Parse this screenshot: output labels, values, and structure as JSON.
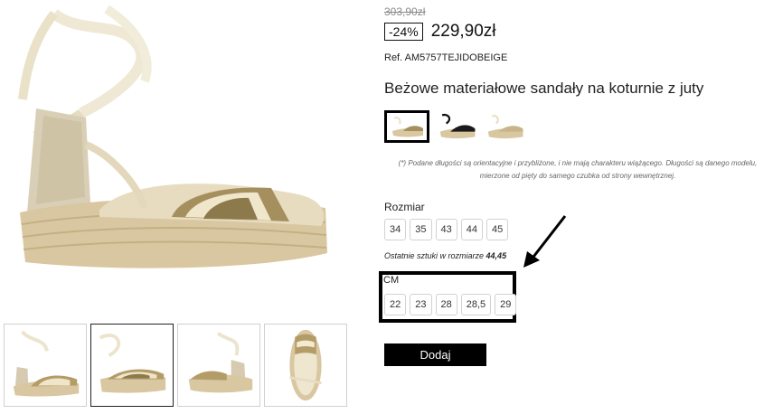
{
  "product": {
    "old_price": "303,90zł",
    "discount": "-24%",
    "price": "229,90zł",
    "reference": "Ref. AM5757TEJIDOBEIGE",
    "title": "Beżowe materiałowe sandały na koturnie z juty"
  },
  "color_options": [
    {
      "name": "beige-icon",
      "selected": true
    },
    {
      "name": "black-icon",
      "selected": false
    },
    {
      "name": "beige-alt-icon",
      "selected": false
    }
  ],
  "disclaimer": {
    "line1": "(*) Podane długości są orientacyjne i przybliżone, i nie mają charakteru wiążącego. Długości są danego modelu,",
    "line2": "mierzone od pięty do samego czubka od strony wewnętrznej."
  },
  "sizes": {
    "label": "Rozmiar",
    "eu": [
      "34",
      "35",
      "43",
      "44",
      "45"
    ],
    "last_pieces_text": "Ostatnie sztuki w rozmiarze",
    "last_pieces_sizes": "44,45",
    "cm_label": "CM",
    "cm": [
      "22",
      "23",
      "28",
      "28,5",
      "29"
    ]
  },
  "add_button": "Dodaj",
  "gallery": {
    "thumbnail_count": 4,
    "selected_index": 1
  },
  "colors": {
    "accent": "#000000",
    "old_price": "#8a8a8a",
    "jute": "#d8c7a0",
    "fabric_stripe": "#9b8a5e"
  }
}
